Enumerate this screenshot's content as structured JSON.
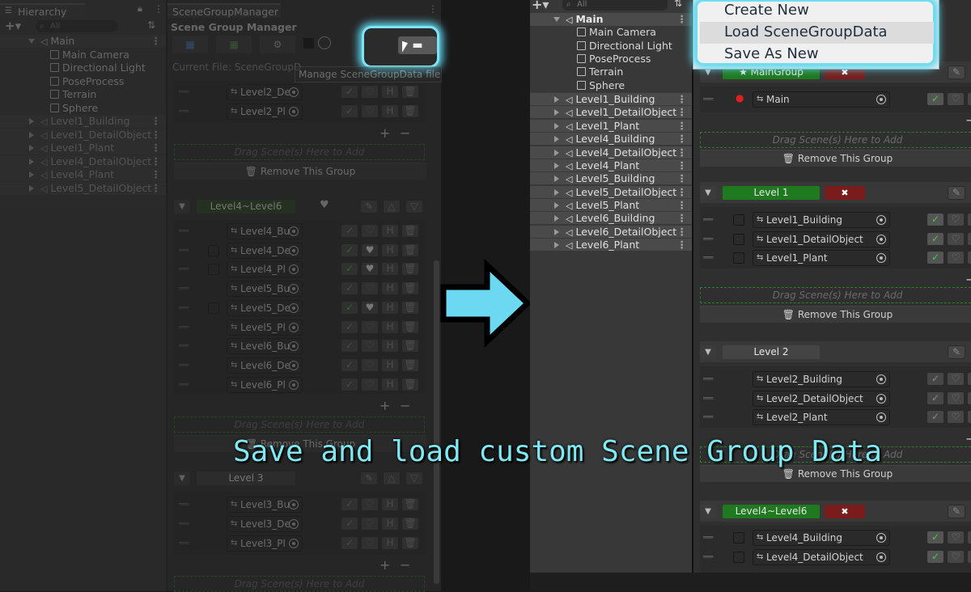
{
  "left": {
    "hierarchy": {
      "tab": "Hierarchy",
      "search_placeholder": "All",
      "root": "Main",
      "children": [
        "Main Camera",
        "Directional Light",
        "PoseProcess",
        "Terrain",
        "Sphere"
      ],
      "scenes": [
        "Level1_Building",
        "Level1_DetailObject",
        "Level1_Plant",
        "Level4_DetailObject",
        "Level4_Plant",
        "Level5_DetailObject"
      ]
    },
    "manager": {
      "tab": "SceneGroupManager",
      "title": "Scene Group Manager",
      "current_file": "Current File: SceneGroupD",
      "tooltip": "Manage SceneGroupData files",
      "level2_rows": [
        "Level2_De",
        "Level2_Pl"
      ],
      "level46_name": "Level4~Level6",
      "level46_rows": [
        "Level4_Bu",
        "Level4_De",
        "Level4_Pl",
        "Level5_Bu",
        "Level5_De",
        "Level5_Pl",
        "Level6_Bu",
        "Level6_De",
        "Level6_Pl"
      ],
      "level3_name": "Level 3",
      "level3_rows": [
        "Level3_Bu",
        "Level3_De",
        "Level3_Pl"
      ],
      "drag_text": "Drag Scene(s) Here to Add",
      "remove_text": "Remove This Group",
      "plus": "+",
      "minus": "−"
    }
  },
  "right": {
    "hierarchy": {
      "search_placeholder": "All",
      "root": "Main",
      "children": [
        "Main Camera",
        "Directional Light",
        "PoseProcess",
        "Terrain",
        "Sphere"
      ],
      "scenes": [
        "Level1_Building",
        "Level1_DetailObject",
        "Level1_Plant",
        "Level4_Building",
        "Level4_DetailObject",
        "Level4_Plant",
        "Level5_Building",
        "Level5_DetailObject",
        "Level5_Plant",
        "Level6_Building",
        "Level6_DetailObject",
        "Level6_Plant"
      ]
    },
    "menu": {
      "items": [
        "Create New",
        "Load SceneGroupData",
        "Save As New"
      ]
    },
    "groups": {
      "main": {
        "name": "★ MainGroup",
        "rows": [
          "Main"
        ]
      },
      "level1": {
        "name": "Level 1",
        "rows": [
          "Level1_Building",
          "Level1_DetailObject",
          "Level1_Plant"
        ]
      },
      "level2": {
        "name": "Level 2",
        "rows": [
          "Level2_Building",
          "Level2_DetailObject",
          "Level2_Plant"
        ]
      },
      "level46": {
        "name": "Level4~Level6",
        "rows": [
          "Level4_Building",
          "Level4_DetailObject"
        ]
      }
    },
    "drag_text": "Drag Scene(s) Here to Add",
    "remove_text": "Remove This Group"
  },
  "caption": "Save and load custom Scene Group Data",
  "colors": {
    "accent_cyan": "#5fd7ee",
    "green": "#1f7a1f",
    "red": "#7a1c1c"
  }
}
